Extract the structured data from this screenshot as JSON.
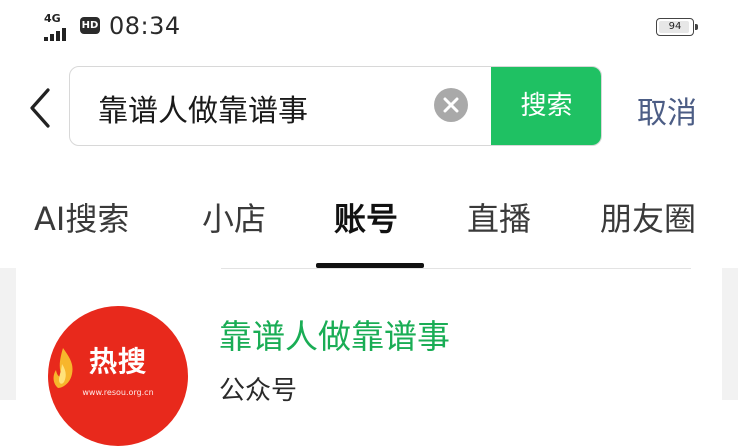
{
  "status_bar": {
    "network": "4G",
    "hd_badge": "HD",
    "time": "08:34",
    "battery": "94",
    "battery_level": 0.94
  },
  "search": {
    "query": "靠谱人做靠谱事",
    "search_button": "搜索",
    "cancel": "取消"
  },
  "tabs": [
    {
      "label": "AI搜索"
    },
    {
      "label": "小店"
    },
    {
      "label": "账号"
    },
    {
      "label": "直播"
    },
    {
      "label": "朋友圈"
    }
  ],
  "active_tab": "账号",
  "results": [
    {
      "name": "靠谱人做靠谱事",
      "type": "公众号",
      "avatar": {
        "text": "热搜",
        "url": "www.resou.org.cn",
        "color": "#e8291c"
      }
    }
  ],
  "colors": {
    "accent_green": "#1fc163",
    "link_blue": "#4c5d85",
    "result_title_green": "#1aad55"
  }
}
